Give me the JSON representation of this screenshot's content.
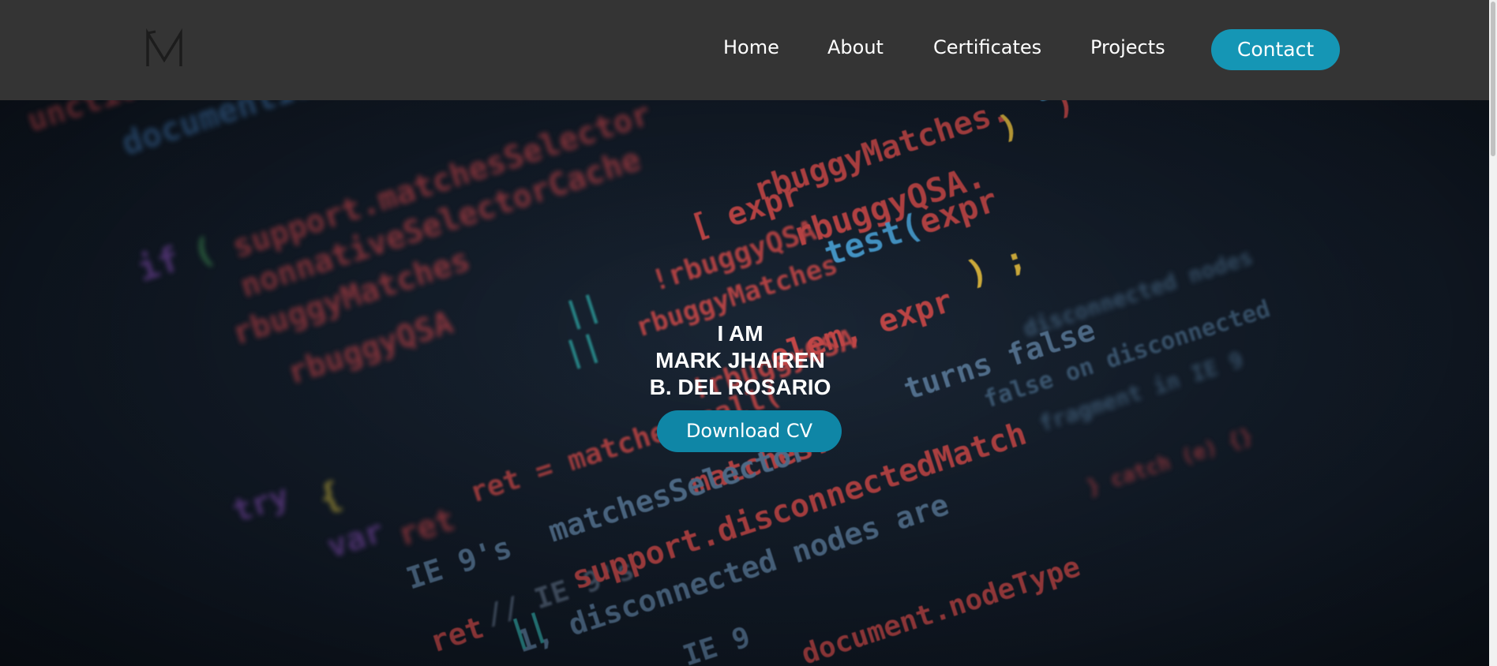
{
  "header": {
    "logo_icon": "M-monogram-logo",
    "nav": {
      "home": "Home",
      "about": "About",
      "certificates": "Certificates",
      "projects": "Projects",
      "contact": "Contact"
    },
    "background_color": "#343434",
    "contact_color": "#1596b5"
  },
  "hero": {
    "line1": "I AM",
    "line2": "MARK JHAIREN",
    "line3": "B. DEL ROSARIO",
    "download_label": "Download CV",
    "download_color": "#0f86a6",
    "background": "blurred-code-editor-image",
    "code_snippets": [
      "expr",
      "rbuggyMatches.test",
      "rbuggyQSA.test( expr",
      "rbuggyMatches",
      "expr );",
      "rbuggyQSA",
      "elem, expr",
      "turns false on disconnected",
      "ret = matches.call",
      "matchesSelector",
      "support.disconnectedMatch",
      "IE 9's matchesSelector",
      "ret ||",
      "disconnected nodes are said to be",
      "IE 9",
      "document.nodeType"
    ]
  }
}
